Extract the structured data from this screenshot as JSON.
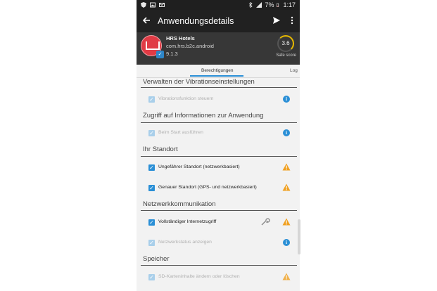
{
  "statusbar": {
    "left_icons": [
      "shield-icon",
      "image-icon",
      "mail-icon"
    ],
    "battery": "7%",
    "time": "1:17"
  },
  "toolbar": {
    "title": "Anwendungsdetails"
  },
  "app": {
    "name": "HRS Hotels",
    "package": "com.hrs.b2c.android",
    "version": "9.1.3",
    "score": "3.6",
    "score_label": "Safe score"
  },
  "tabs": [
    {
      "label": "Berechtigungen",
      "active": true
    },
    {
      "label": "Log",
      "active": false
    }
  ],
  "sections": [
    {
      "title": "Verwalten der Vibrationseinstellungen",
      "items": [
        {
          "label": "Vibrationsfunktion steuern",
          "checked": true,
          "enabled": false,
          "icon": "info-icon"
        }
      ]
    },
    {
      "title": "Zugriff auf Informationen zur Anwendung",
      "items": [
        {
          "label": "Beim Start ausführen",
          "checked": true,
          "enabled": false,
          "icon": "info-icon"
        }
      ]
    },
    {
      "title": "Ihr Standort",
      "items": [
        {
          "label": "Ungefährer Standort (netzwerkbasiert)",
          "checked": true,
          "enabled": true,
          "icon": "warning-icon"
        },
        {
          "label": "Genauer Standort (GPS- und netzwerkbasiert)",
          "checked": true,
          "enabled": true,
          "icon": "warning-icon"
        }
      ]
    },
    {
      "title": "Netzwerkkommunikation",
      "items": [
        {
          "label": "Vollständiger Internetzugriff",
          "checked": true,
          "enabled": true,
          "icon": "warning-icon",
          "extra": "wrench-icon"
        },
        {
          "label": "Netzwerkstatus anzeigen",
          "checked": true,
          "enabled": false,
          "icon": "info-icon"
        }
      ]
    },
    {
      "title": "Speicher",
      "items": [
        {
          "label": "SD-Karteninhalte ändern oder löschen",
          "checked": true,
          "enabled": false,
          "icon": "warning-icon"
        }
      ]
    }
  ],
  "colors": {
    "accent": "#2a8fd6",
    "warning": "#f0a020",
    "toolbar": "#212121",
    "header": "#373737"
  }
}
